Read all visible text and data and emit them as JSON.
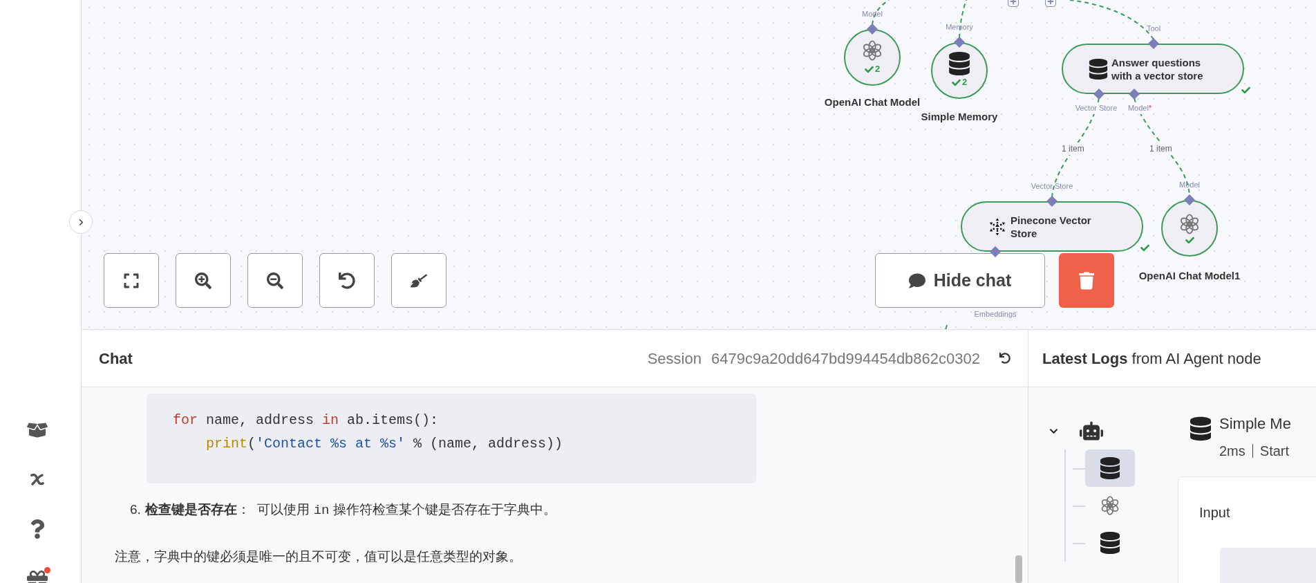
{
  "canvas": {
    "nodes": [
      {
        "kind": "model",
        "label": "OpenAI Chat Model",
        "count": "2",
        "success": true,
        "inputs": [
          {
            "label": "Model"
          }
        ]
      },
      {
        "kind": "memory",
        "label": "Simple Memory",
        "count": "2",
        "success": true,
        "inputs": [
          {
            "label": "Memory"
          }
        ]
      },
      {
        "kind": "tool",
        "label": "Answer questions with a vector store",
        "success": true,
        "inputs": [
          {
            "label": "Tool"
          }
        ],
        "outputs": [
          {
            "label": "Vector Store"
          },
          {
            "label": "Model",
            "required_mark": "*"
          }
        ]
      },
      {
        "kind": "vector_store",
        "label": "Pinecone Vector Store",
        "success": true,
        "inputs": [
          {
            "label": "Vector Store"
          }
        ],
        "outputs": [
          {
            "label": "Embeddings"
          }
        ]
      },
      {
        "kind": "model",
        "label": "OpenAI Chat Model1",
        "success": true,
        "inputs": [
          {
            "label": "Model"
          }
        ]
      }
    ],
    "edge_labels": [
      "1 item",
      "1 item"
    ],
    "hide_chat_button": "Hide chat"
  },
  "chat": {
    "title": "Chat",
    "session_label": "Session",
    "session_id": "6479c9a20dd647bd994454db862c0302",
    "code_lines": [
      {
        "indent": false,
        "tokens": [
          {
            "kind": "keyword",
            "text": "for"
          },
          {
            "kind": "plain",
            "text": " name, address "
          },
          {
            "kind": "keyword",
            "text": "in"
          },
          {
            "kind": "plain",
            "text": " ab.items():"
          }
        ]
      },
      {
        "indent": true,
        "tokens": [
          {
            "kind": "builtin",
            "text": "print"
          },
          {
            "kind": "plain",
            "text": "("
          },
          {
            "kind": "string",
            "text": "'Contact %s at %s'"
          },
          {
            "kind": "plain",
            "text": " % (name, address))"
          }
        ]
      }
    ],
    "list_item": {
      "number": "6.",
      "segments": [
        {
          "kind": "bold",
          "text": "检查键是否存在"
        },
        {
          "kind": "text",
          "text": "：  可以使用 "
        },
        {
          "kind": "code",
          "text": "in"
        },
        {
          "kind": "text",
          "text": " 操作符检查某个键是否存在于字典中。"
        }
      ]
    },
    "note": "注意，字典中的键必须是唯一的且不可变，值可以是任意类型的对象。"
  },
  "logs": {
    "title": "**Latest Logs** from AI Agent node",
    "tree": [
      {
        "kind": "agent",
        "expanded": true,
        "children": [
          {
            "kind": "memory",
            "selected": true
          },
          {
            "kind": "model",
            "selected": false
          },
          {
            "kind": "memory",
            "selected": false
          }
        ]
      }
    ],
    "detail": {
      "name": "Simple Me",
      "duration": "2ms",
      "started": "Start",
      "section": "Input"
    }
  }
}
